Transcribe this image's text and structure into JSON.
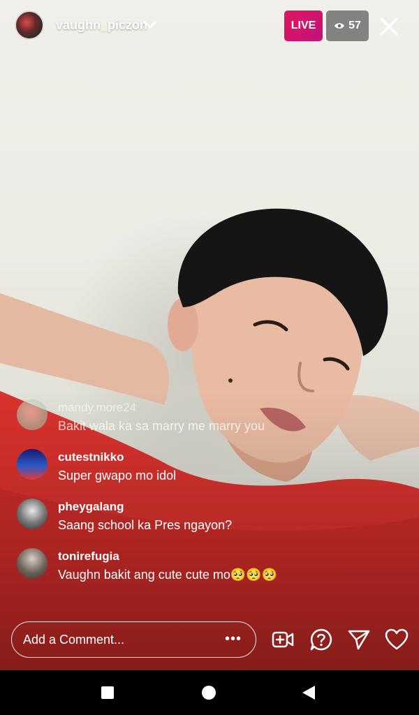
{
  "header": {
    "username": "vaughn_piczon",
    "live_label": "LIVE",
    "viewer_count": "57",
    "live_color": "#D9155F"
  },
  "comments": [
    {
      "username": "mandy.more24",
      "text": "Bakit wala ka sa marry me marry you",
      "avatar_color": "#a6c9b0"
    },
    {
      "username": "cutestnikko",
      "text": "Super gwapo mo idol",
      "avatar_color": "#2a59c9"
    },
    {
      "username": "pheygalang",
      "text": "Saang school ka Pres ngayon?",
      "avatar_color": "#4a4a4a"
    },
    {
      "username": "tonirefugia",
      "text": "Vaughn bakit ang cute cute mo🥺🥺🥺",
      "avatar_color": "#6d6058"
    }
  ],
  "composer": {
    "placeholder": "Add a Comment...",
    "more_label": "•••"
  },
  "icons": {
    "add_video": "add-video-icon",
    "question": "question-icon",
    "share": "send-icon",
    "like": "heart-icon",
    "close": "close-icon"
  }
}
